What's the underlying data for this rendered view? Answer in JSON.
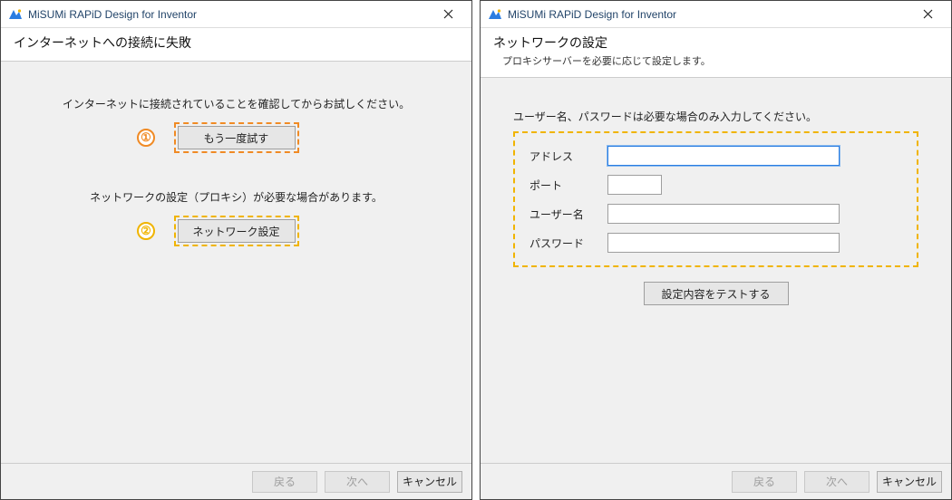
{
  "app_title": "MiSUMi RAPiD Design for Inventor",
  "markers": {
    "one": "①",
    "two": "②"
  },
  "left": {
    "header_title": "インターネットへの接続に失敗",
    "msg1": "インターネットに接続されていることを確認してからお試しください。",
    "retry_label": "もう一度試す",
    "msg2": "ネットワークの設定（プロキシ）が必要な場合があります。",
    "network_label": "ネットワーク設定"
  },
  "right": {
    "header_title": "ネットワークの設定",
    "header_sub": "プロキシサーバーを必要に応じて設定します。",
    "instruct": "ユーザー名、パスワードは必要な場合のみ入力してください。",
    "form": {
      "address_label": "アドレス",
      "port_label": "ポート",
      "user_label": "ユーザー名",
      "pass_label": "パスワード",
      "address_value": "",
      "port_value": "",
      "user_value": "",
      "pass_value": ""
    },
    "test_label": "設定内容をテストする"
  },
  "footer": {
    "back": "戻る",
    "next": "次へ",
    "cancel": "キャンセル"
  },
  "colors": {
    "highlight_orange": "#f08a24",
    "highlight_yellow": "#f0b400",
    "focus_blue": "#2a7de1"
  }
}
